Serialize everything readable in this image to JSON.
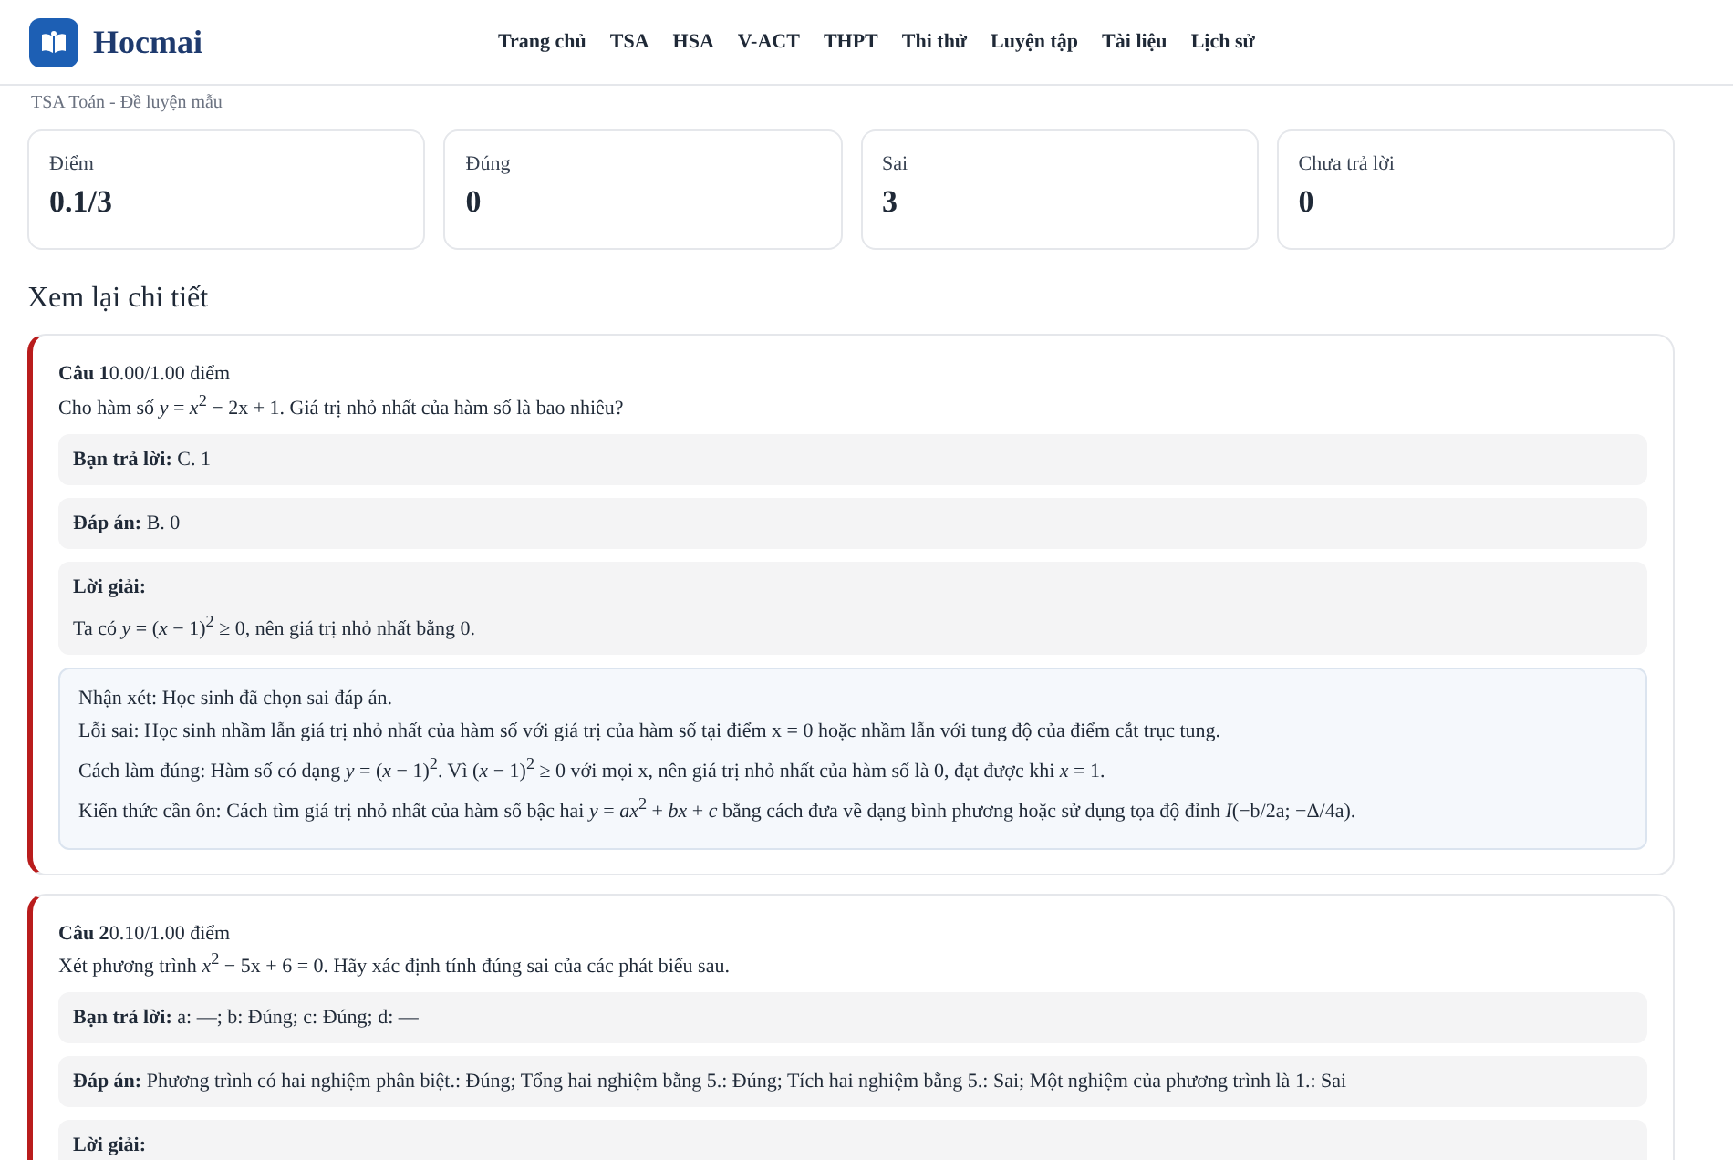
{
  "header": {
    "brand": "Hocmai",
    "nav": [
      {
        "label": "Trang chủ"
      },
      {
        "label": "TSA"
      },
      {
        "label": "HSA"
      },
      {
        "label": "V-ACT"
      },
      {
        "label": "THPT"
      },
      {
        "label": "Thi thử"
      },
      {
        "label": "Luyện tập"
      },
      {
        "label": "Tài liệu"
      },
      {
        "label": "Lịch sử"
      }
    ]
  },
  "breadcrumb": "TSA Toán - Đề luyện mẫu",
  "stats": [
    {
      "label": "Điểm",
      "value": "0.1/3"
    },
    {
      "label": "Đúng",
      "value": "0"
    },
    {
      "label": "Sai",
      "value": "3"
    },
    {
      "label": "Chưa trả lời",
      "value": "0"
    }
  ],
  "section_title": "Xem lại chi tiết",
  "questions": [
    {
      "label": "Câu 1",
      "score": "0.00/1.00 điểm",
      "correct": false,
      "prompt": "Cho hàm số *y* = *x*$^{2}$ − 2x + 1. Giá trị nhỏ nhất của hàm số là bao nhiêu?",
      "rows": [
        {
          "label": "Bạn trả lời:",
          "value": "C. 1"
        },
        {
          "label": "Đáp án:",
          "value": "B. 0"
        }
      ],
      "solution": {
        "label": "Lời giải:",
        "text": "Ta có *y* = (*x* − 1)$^{2}$ ≥ 0, nên giá trị nhỏ nhất bằng 0."
      },
      "feedback": [
        "Nhận xét: Học sinh đã chọn sai đáp án.",
        "Lỗi sai: Học sinh nhầm lẫn giá trị nhỏ nhất của hàm số với giá trị của hàm số tại điểm x = 0 hoặc nhầm lẫn với tung độ của điểm cắt trục tung.",
        "Cách làm đúng: Hàm số có dạng *y* = (*x* − 1)$^{2}$. Vì (*x* − 1)$^{2}$ ≥ 0 với mọi x, nên giá trị nhỏ nhất của hàm số là 0, đạt được khi *x* = 1.",
        "Kiến thức cần ôn: Cách tìm giá trị nhỏ nhất của hàm số bậc hai *y* = *ax*$^{2}$ + *bx* + *c* bằng cách đưa về dạng bình phương hoặc sử dụng tọa độ đỉnh *I*(−b/2a; −Δ/4a)."
      ]
    },
    {
      "label": "Câu 2",
      "score": "0.10/1.00 điểm",
      "correct": false,
      "prompt": "Xét phương trình *x*$^{2}$ − 5x + 6 = 0. Hãy xác định tính đúng sai của các phát biểu sau.",
      "rows": [
        {
          "label": "Bạn trả lời:",
          "value": "a: —; b: Đúng; c: Đúng; d: —"
        },
        {
          "label": "Đáp án:",
          "value": "Phương trình có hai nghiệm phân biệt.: Đúng; Tổng hai nghiệm bằng 5.: Đúng; Tích hai nghiệm bằng 5.: Sai; Một nghiệm của phương trình là 1.: Sai"
        }
      ],
      "solution": {
        "label": "Lời giải:"
      }
    }
  ]
}
